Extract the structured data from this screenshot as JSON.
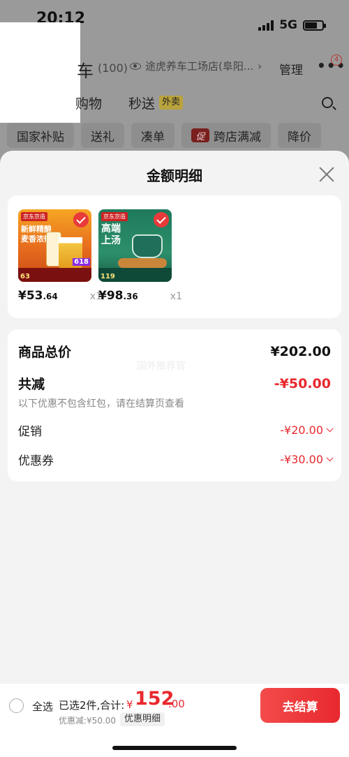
{
  "status_bar": {
    "time": "20:12",
    "network": "5G"
  },
  "background": {
    "cart_title_partial": "车",
    "cart_count": "(100)",
    "store_name": "途虎养车工场店(阜阳...",
    "store_arrow": "›",
    "manage_label": "管理",
    "more_label": "•••",
    "badge_count": "4",
    "tab_shopping_partial": "购物",
    "tab_seckill": "秒送",
    "takeout_tag": "外卖",
    "filters": [
      "国家补贴",
      "送礼",
      "凑单",
      "跨店满减",
      "降价"
    ],
    "promo_tag": "促"
  },
  "sheet": {
    "title": "金额明细",
    "products": [
      {
        "price_int": "¥53",
        "price_dec": ".64",
        "qty": "x1",
        "brand": "京东京造",
        "headline": "新鲜精酿\n麦香浓郁",
        "badge": "618",
        "bottom_price": "63"
      },
      {
        "price_int": "¥98",
        "price_dec": ".36",
        "qty": "x1",
        "brand": "京东京造",
        "headline": "高端\n上汤",
        "bottom_price": "119"
      }
    ],
    "summary": {
      "watermark": "国外推荐官",
      "goods_total_label": "商品总价",
      "goods_total_value": "¥202.00",
      "total_reduce_label": "共减",
      "total_reduce_value": "-¥50.00",
      "note": "以下优惠不包含红包，请在结算页查看",
      "promo_label": "促销",
      "promo_value": "-¥20.00",
      "coupon_label": "优惠券",
      "coupon_value": "-¥30.00"
    }
  },
  "bottom_bar": {
    "select_all": "全选",
    "selected_info": "已选2件,合计:",
    "currency": "¥",
    "total_int": "152",
    "total_dec": ".00",
    "discount_line": "优惠减:¥50.00",
    "detail_tag": "优惠明细",
    "checkout": "去结算"
  },
  "colors": {
    "accent_red": "#e8292f",
    "sheet_bg": "#f3f3f3",
    "dim_bg": "#9a9a9a"
  }
}
